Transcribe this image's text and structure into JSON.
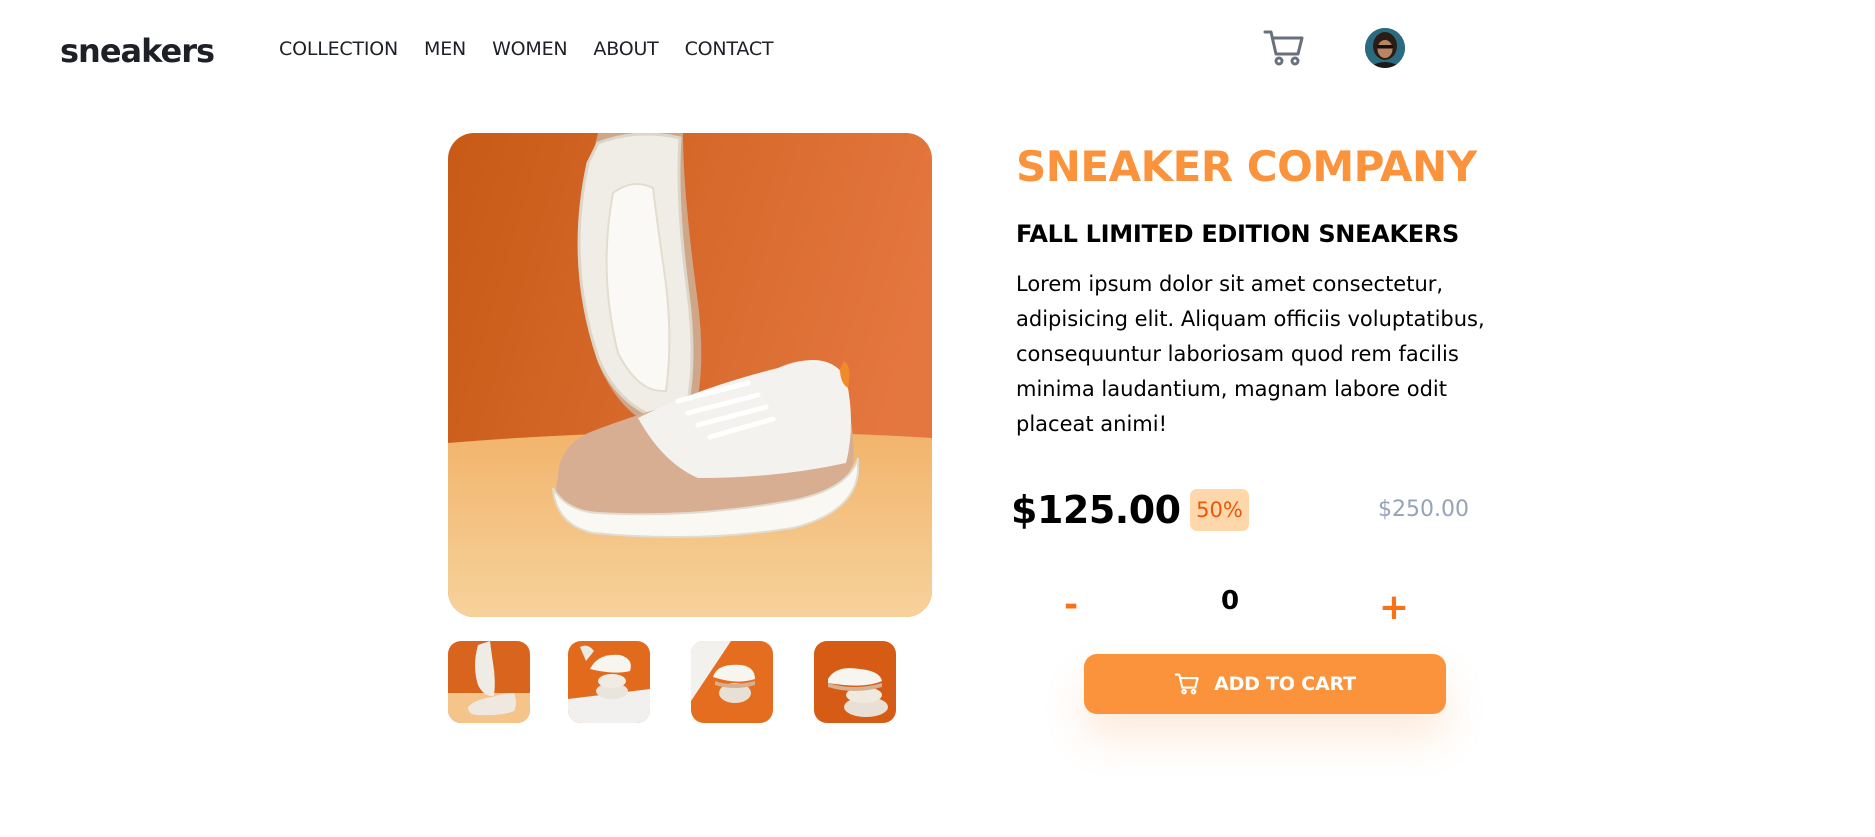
{
  "header": {
    "logo": "sneakers",
    "nav": [
      "COLLECTION",
      "MEN",
      "WOMEN",
      "ABOUT",
      "CONTACT"
    ],
    "cart_icon": "cart-icon",
    "avatar_icon": "avatar"
  },
  "product": {
    "company": "SNEAKER COMPANY",
    "title": "FALL LIMITED EDITION SNEAKERS",
    "description": "Lorem ipsum dolor sit amet consectetur, adipisicing elit. Aliquam officiis voluptatibus, consequuntur laboriosam quod rem facilis minima laudantium, magnam labore odit placeat animi!",
    "price": "$125.00",
    "discount": "50%",
    "old_price": "$250.00"
  },
  "quantity": {
    "minus_label": "-",
    "value": "0",
    "plus_label": "+"
  },
  "cart_button": {
    "label": "ADD TO CART",
    "icon": "cart-icon"
  },
  "colors": {
    "accent": "#fb923c",
    "accent_dark": "#f97316",
    "badge_bg": "#fed7aa",
    "badge_text": "#ea580c",
    "muted": "#94a3b8"
  }
}
